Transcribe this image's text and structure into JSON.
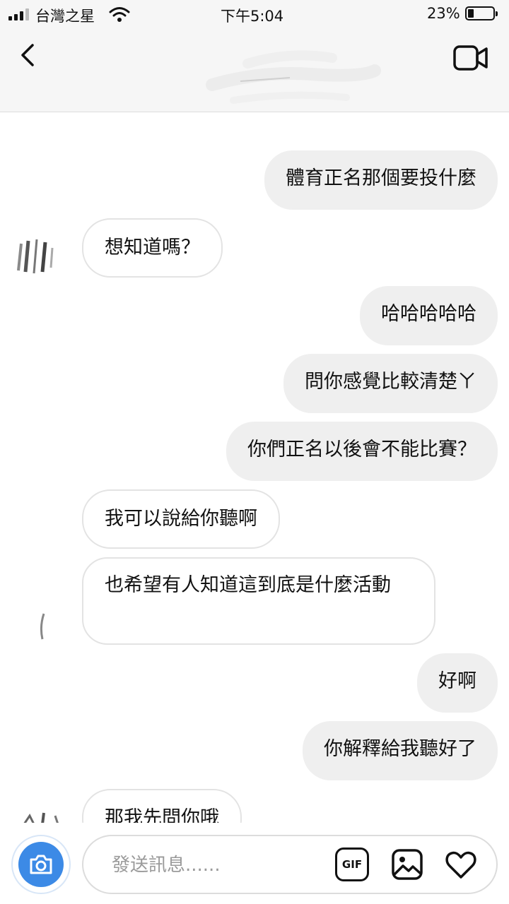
{
  "status_bar": {
    "carrier": "台灣之星",
    "time": "下午5:04",
    "battery_percent": "23%",
    "battery_level": 0.23
  },
  "header": {
    "back_icon": "chevron-left-icon",
    "video_icon": "video-camera-icon"
  },
  "messages": [
    {
      "direction": "out",
      "text": "體育正名那個要投什麼"
    },
    {
      "direction": "in",
      "text": "想知道嗎？"
    },
    {
      "direction": "out",
      "text": "哈哈哈哈哈"
    },
    {
      "direction": "out",
      "text": "問你感覺比較清楚ㄚ"
    },
    {
      "direction": "out",
      "text": "你們正名以後會不能比賽？"
    },
    {
      "direction": "in",
      "text": "我可以說給你聽啊"
    },
    {
      "direction": "in",
      "text": "也希望有人知道這到底是什麼活動"
    },
    {
      "direction": "out",
      "text": "好啊"
    },
    {
      "direction": "out",
      "text": "你解釋給我聽好了"
    },
    {
      "direction": "in",
      "text": "那我先問你哦"
    }
  ],
  "composer": {
    "placeholder": "發送訊息......",
    "gif_label": "GIF",
    "camera_icon": "camera-icon",
    "gallery_icon": "image-gallery-icon",
    "heart_icon": "heart-icon",
    "accent_color": "#3c8ae6"
  }
}
